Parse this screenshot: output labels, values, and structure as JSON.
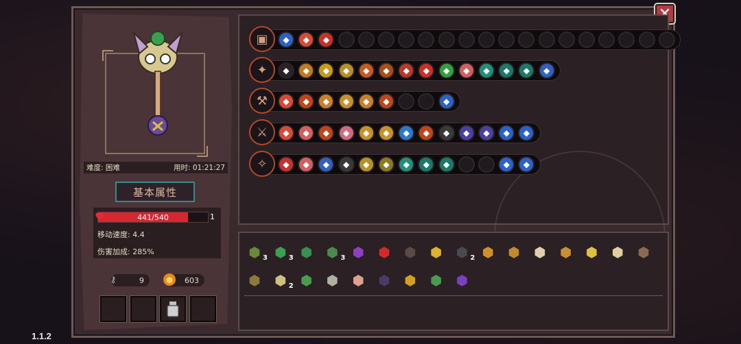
{
  "version": "1.1.2",
  "close_label": "✕",
  "info": {
    "difficulty": "难度: 困难",
    "time": "用时: 01:21:27"
  },
  "attr_title": "基本属性",
  "hp": {
    "text": "441/540",
    "fraction": 0.8167,
    "level": "1"
  },
  "stats": {
    "move_speed": "移动速度: 4.4",
    "damage_bonus": "伤害加成: 285%"
  },
  "resources": {
    "keys": "9",
    "coins": "603"
  },
  "slots": [
    "",
    "",
    "potion-icon",
    ""
  ],
  "skill_rows": [
    {
      "weapon": "chest-icon",
      "gems": [
        "#2a62c9",
        "#d64a36",
        "#c8302a",
        "",
        "",
        "",
        "",
        "",
        "",
        "",
        "",
        "",
        "",
        "",
        "",
        "",
        "",
        "",
        "",
        ""
      ]
    },
    {
      "weapon": "staff-icon",
      "gems": [
        "#2a2226",
        "#c07a20",
        "#c79a20",
        "#b8902a",
        "#c75a20",
        "#a8501a",
        "#b83a2a",
        "#c8302a",
        "#30a040",
        "#d06060",
        "#20907a",
        "#1a7a6a",
        "#1a7a6a",
        "#3060c0"
      ]
    },
    {
      "weapon": "axe-icon",
      "gems": [
        "#d64a36",
        "#c0451a",
        "#c8802a",
        "#c8902a",
        "#c8802a",
        "#c0451a",
        "",
        "",
        "#2a62c9"
      ]
    },
    {
      "weapon": "sword-icon",
      "gems": [
        "#d64a36",
        "#d06060",
        "#c0451a",
        "#d06a80",
        "#c8902a",
        "#c8902a",
        "#2a7ac9",
        "#c0451a",
        "#3a3a3a",
        "#4a40a0",
        "#4a40a0",
        "#2a62c9",
        "#2a62c9"
      ]
    },
    {
      "weapon": "wand-icon",
      "gems": [
        "#c8302a",
        "#d06060",
        "#3060c0",
        "#3a3a3a",
        "#b8902a",
        "#8a7a20",
        "#20907a",
        "#1a7a6a",
        "#1a7a6a",
        "",
        "",
        "#2a62c9",
        "#2a62c9"
      ]
    }
  ],
  "items_row1": [
    {
      "icon": "helmet-icon",
      "color": "#6a8a3a",
      "count": "3"
    },
    {
      "icon": "clover-icon",
      "color": "#3aa050",
      "count": "3"
    },
    {
      "icon": "leaf-icon",
      "color": "#3a9050",
      "count": ""
    },
    {
      "icon": "scarf-icon",
      "color": "#4a8a4a",
      "count": "3"
    },
    {
      "icon": "witch-hat-icon",
      "color": "#8a40c0",
      "count": ""
    },
    {
      "icon": "eye-icon",
      "color": "#d02a2a",
      "count": ""
    },
    {
      "icon": "armor-icon",
      "color": "#5a4a4a",
      "count": ""
    },
    {
      "icon": "crystal-icon",
      "color": "#e0b030",
      "count": ""
    },
    {
      "icon": "cloak-icon",
      "color": "#4a4a50",
      "count": "2"
    },
    {
      "icon": "goblet-icon",
      "color": "#d0902a",
      "count": ""
    },
    {
      "icon": "bow-icon",
      "color": "#c08a30",
      "count": ""
    },
    {
      "icon": "feather-icon",
      "color": "#e0d0b0",
      "count": ""
    },
    {
      "icon": "pickaxe-icon",
      "color": "#c89030",
      "count": ""
    },
    {
      "icon": "horn-icon",
      "color": "#e0c040",
      "count": ""
    },
    {
      "icon": "glasses-icon",
      "color": "#e0d0a0",
      "count": ""
    },
    {
      "icon": "bell-icon",
      "color": "#8a6a50",
      "count": ""
    }
  ],
  "items_row2": [
    {
      "icon": "coffin-icon",
      "color": "#8a7a40",
      "count": ""
    },
    {
      "icon": "fang-icon",
      "color": "#d0c080",
      "count": "2"
    },
    {
      "icon": "sprout-icon",
      "color": "#4a9a50",
      "count": ""
    },
    {
      "icon": "bone-icon",
      "color": "#b0b0a0",
      "count": ""
    },
    {
      "icon": "piggy-icon",
      "color": "#e0a090",
      "count": ""
    },
    {
      "icon": "robe-icon",
      "color": "#4a3a6a",
      "count": ""
    },
    {
      "icon": "gauntlet-icon",
      "color": "#d0a020",
      "count": ""
    },
    {
      "icon": "boot-icon",
      "color": "#4a9a50",
      "count": ""
    },
    {
      "icon": "cape-icon",
      "color": "#7a40c0",
      "count": ""
    }
  ]
}
